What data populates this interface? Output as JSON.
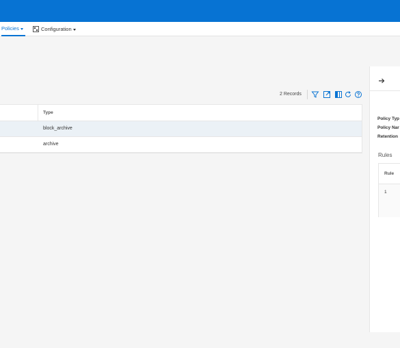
{
  "nav": {
    "policies_label": "Policies",
    "configuration_label": "Configuration"
  },
  "toolbar": {
    "records": "2 Records",
    "icons": [
      "filter-icon",
      "export-icon",
      "columns-icon",
      "refresh-icon",
      "help-icon"
    ]
  },
  "table": {
    "columns": [
      "",
      "Type"
    ],
    "rows": [
      {
        "type": "block_archive",
        "selected": true
      },
      {
        "type": "archive",
        "selected": false
      }
    ]
  },
  "panel": {
    "fields": [
      "Policy Typ",
      "Policy Nar",
      "Retention"
    ],
    "rules_title": "Rules",
    "rules_header": "Rule",
    "rules_rows": [
      "1"
    ]
  },
  "colors": {
    "brand": "#0773d3",
    "selected_row": "#ebf1f6"
  }
}
